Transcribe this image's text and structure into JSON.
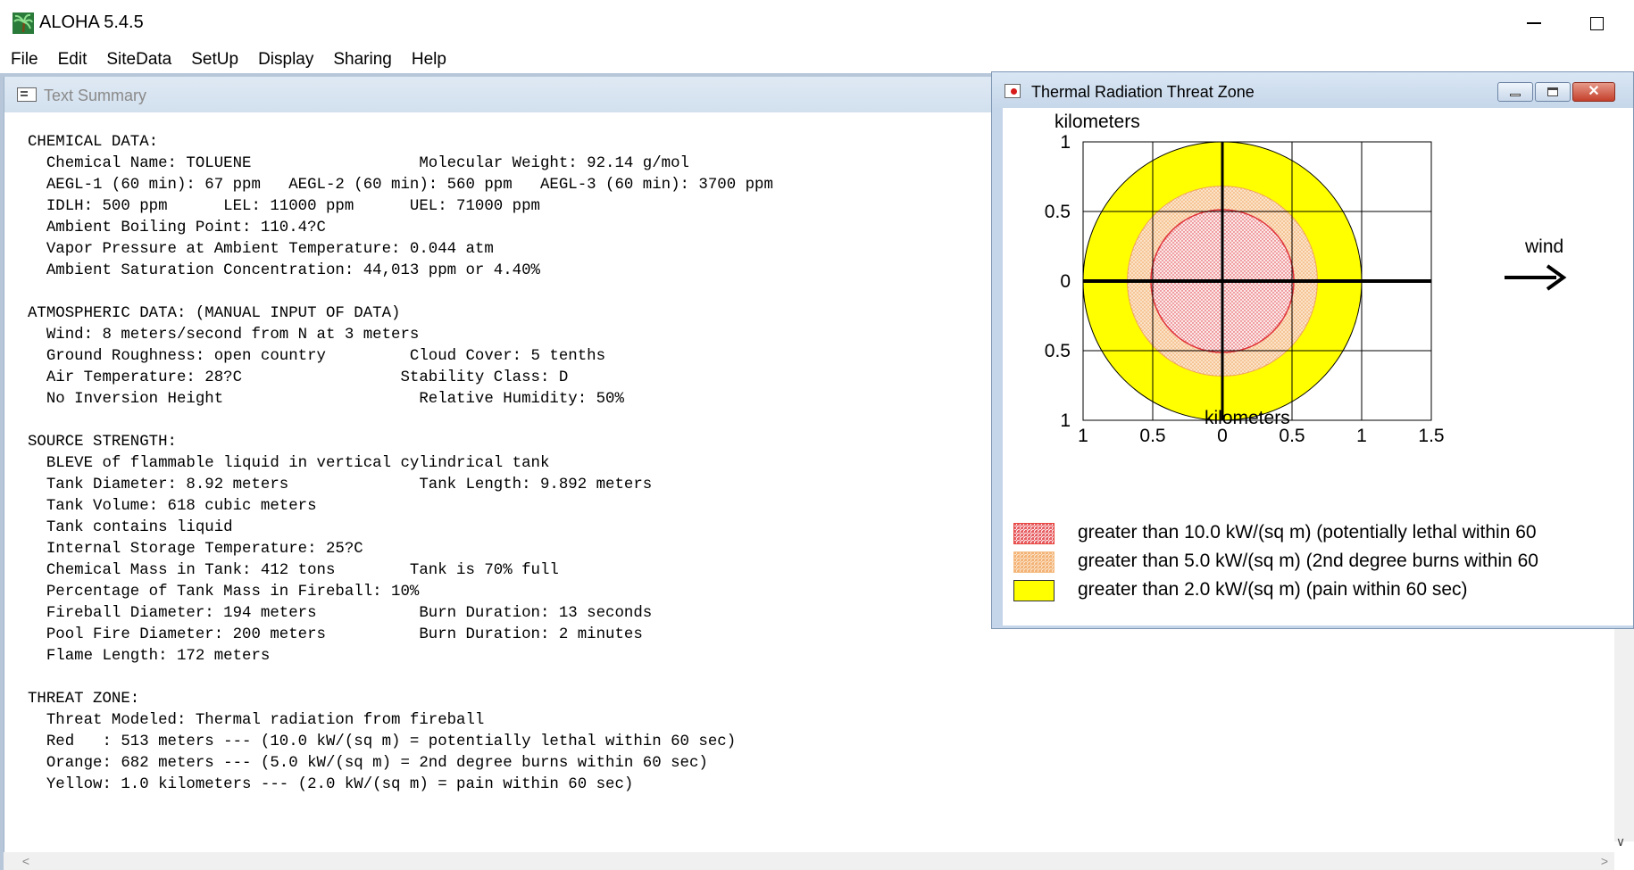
{
  "app": {
    "title": "ALOHA 5.4.5",
    "icon": "palm-tree-icon"
  },
  "menu": [
    "File",
    "Edit",
    "SiteData",
    "SetUp",
    "Display",
    "Sharing",
    "Help"
  ],
  "text_summary": {
    "title": "Text Summary",
    "lines": [
      "CHEMICAL DATA:",
      "  Chemical Name: TOLUENE                  Molecular Weight: 92.14 g/mol",
      "  AEGL-1 (60 min): 67 ppm   AEGL-2 (60 min): 560 ppm   AEGL-3 (60 min): 3700 ppm",
      "  IDLH: 500 ppm      LEL: 11000 ppm      UEL: 71000 ppm",
      "  Ambient Boiling Point: 110.4?C",
      "  Vapor Pressure at Ambient Temperature: 0.044 atm",
      "  Ambient Saturation Concentration: 44,013 ppm or 4.40%",
      "",
      "ATMOSPHERIC DATA: (MANUAL INPUT OF DATA)",
      "  Wind: 8 meters/second from N at 3 meters",
      "  Ground Roughness: open country         Cloud Cover: 5 tenths",
      "  Air Temperature: 28?C                 Stability Class: D",
      "  No Inversion Height                     Relative Humidity: 50%",
      "",
      "SOURCE STRENGTH:",
      "  BLEVE of flammable liquid in vertical cylindrical tank",
      "  Tank Diameter: 8.92 meters              Tank Length: 9.892 meters",
      "  Tank Volume: 618 cubic meters",
      "  Tank contains liquid",
      "  Internal Storage Temperature: 25?C",
      "  Chemical Mass in Tank: 412 tons        Tank is 70% full",
      "  Percentage of Tank Mass in Fireball: 10%",
      "  Fireball Diameter: 194 meters           Burn Duration: 13 seconds",
      "  Pool Fire Diameter: 200 meters          Burn Duration: 2 minutes",
      "  Flame Length: 172 meters",
      "",
      "THREAT ZONE:",
      "  Threat Modeled: Thermal radiation from fireball",
      "  Red   : 513 meters --- (10.0 kW/(sq m) = potentially lethal within 60 sec)",
      "  Orange: 682 meters --- (5.0 kW/(sq m) = 2nd degree burns within 60 sec)",
      "  Yellow: 1.0 kilometers --- (2.0 kW/(sq m) = pain within 60 sec)"
    ]
  },
  "threat_zone": {
    "title": "Thermal Radiation Threat Zone",
    "y_axis_label": "kilometers",
    "x_axis_label": "kilometers",
    "wind_label": "wind",
    "x_ticks": [
      "1",
      "0.5",
      "0",
      "0.5",
      "1",
      "1.5"
    ],
    "y_ticks": [
      "1",
      "0.5",
      "0",
      "0.5",
      "1"
    ],
    "legend": [
      {
        "label": "greater than 10.0 kW/(sq m) (potentially lethal within 60",
        "color": "#e8433b",
        "pattern": "red-dots"
      },
      {
        "label": "greater than 5.0 kW/(sq m) (2nd degree burns within 60",
        "color": "#f5c08a",
        "pattern": "orange-dots"
      },
      {
        "label": "greater than 2.0 kW/(sq m) (pain within 60 sec)",
        "color": "#ffff00",
        "pattern": "solid"
      }
    ],
    "zones_km": {
      "red": 0.513,
      "orange": 0.682,
      "yellow": 1.0
    },
    "x_range_km": [
      -1,
      1.5
    ],
    "y_range_km": [
      -1,
      1
    ]
  }
}
